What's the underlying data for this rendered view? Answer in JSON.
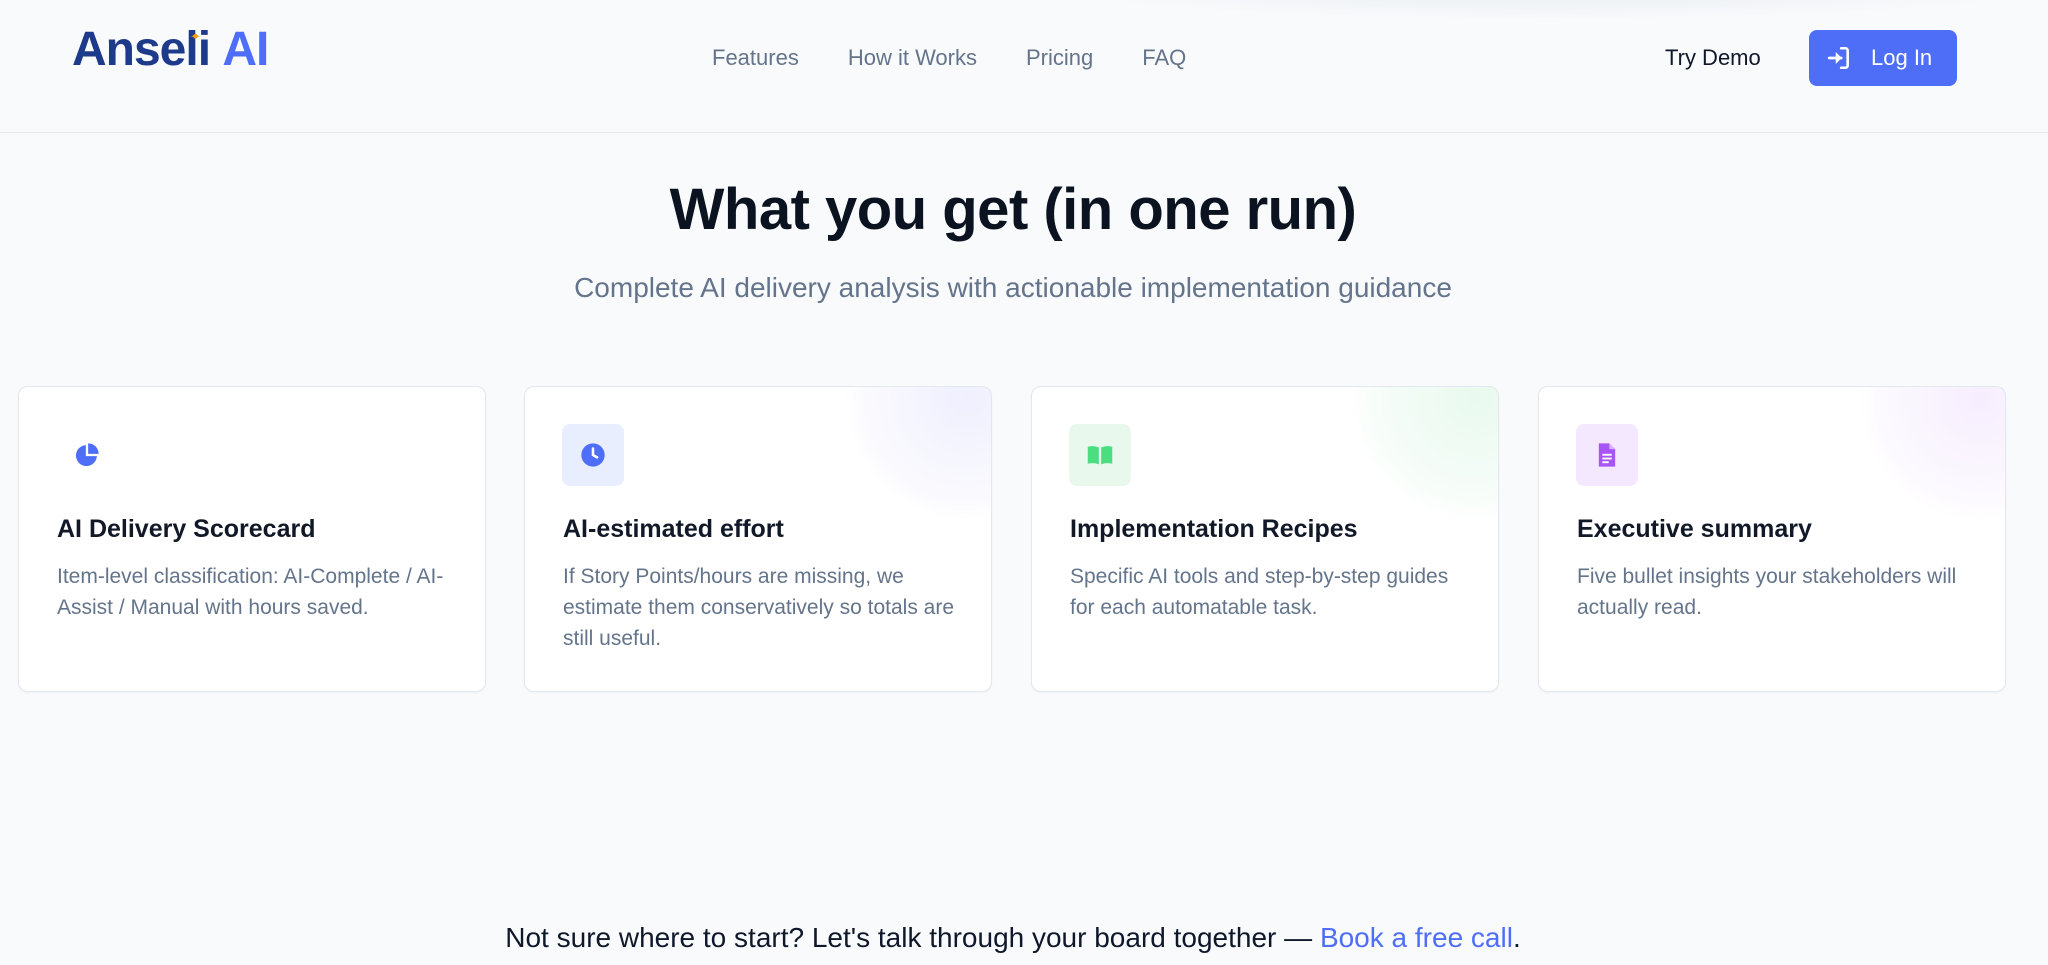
{
  "nav": {
    "logo_main": "Anseli",
    "logo_accent": "AI",
    "links": [
      "Features",
      "How it Works",
      "Pricing",
      "FAQ"
    ],
    "try_demo": "Try Demo",
    "login_label": "Log In"
  },
  "hero": {
    "title": "What you get (in one run)",
    "subtitle": "Complete AI delivery analysis with actionable implementation guidance"
  },
  "cards": [
    {
      "icon": "pie-chart-icon",
      "title": "AI Delivery Scorecard",
      "description": "Item-level classification: AI-Complete / AI-Assist / Manual with hours saved."
    },
    {
      "icon": "clock-icon",
      "title": "AI-estimated effort",
      "description": "If Story Points/hours are missing, we estimate them conservatively so totals are still useful."
    },
    {
      "icon": "book-icon",
      "title": "Implementation Recipes",
      "description": "Specific AI tools and step-by-step guides for each automatable task."
    },
    {
      "icon": "document-icon",
      "title": "Executive summary",
      "description": "Five bullet insights your stakeholders will actually read."
    }
  ],
  "cta": {
    "text": "Not sure where to start? Let's talk through your board together — ",
    "link": "Book a free call",
    "suffix": "."
  },
  "colors": {
    "brand_dark": "#1e3a8a",
    "brand_accent": "#4f6ef7",
    "sparkle": "#f59e0b",
    "icon_green": "#4ade80",
    "icon_purple": "#a855f7"
  }
}
